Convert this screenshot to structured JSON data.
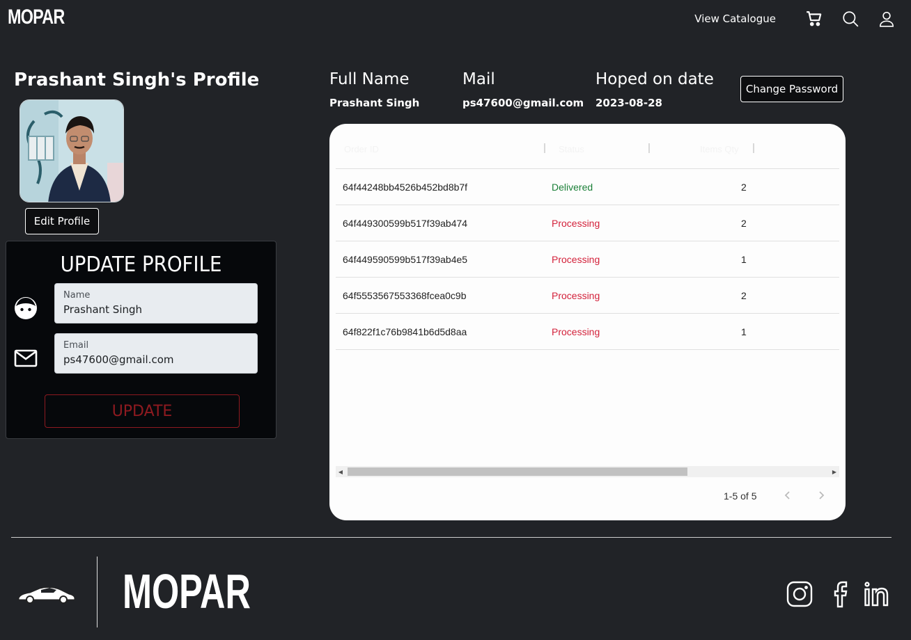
{
  "nav": {
    "logo": "MOPAR",
    "link": "View Catalogue",
    "icons": [
      "cart-icon",
      "search-icon",
      "user-icon"
    ]
  },
  "profile": {
    "title": "Prashant Singh's Profile",
    "edit_label": "Edit Profile"
  },
  "update": {
    "title": "UPDATE PROFILE",
    "name_label": "Name",
    "name_value": "Prashant Singh",
    "email_label": "Email",
    "email_value": "ps47600@gmail.com",
    "button": "UPDATE"
  },
  "info": {
    "full_name_head": "Full Name",
    "full_name": "Prashant Singh",
    "mail_head": "Mail",
    "mail": "ps47600@gmail.com",
    "date_head": "Hoped on date",
    "date": "2023-08-28",
    "change_password": "Change Password"
  },
  "orders": {
    "columns": [
      "Order ID",
      "Status",
      "Items Qty"
    ],
    "rows": [
      {
        "id": "64f44248bb4526b452bd8b7f",
        "status": "Delivered",
        "qty": "2"
      },
      {
        "id": "64f449300599b517f39ab474",
        "status": "Processing",
        "qty": "2"
      },
      {
        "id": "64f449590599b517f39ab4e5",
        "status": "Processing",
        "qty": "1"
      },
      {
        "id": "64f5553567553368fcea0c9b",
        "status": "Processing",
        "qty": "2"
      },
      {
        "id": "64f822f1c76b9841b6d5d8aa",
        "status": "Processing",
        "qty": "1"
      }
    ],
    "pagination": "1-5 of 5"
  },
  "footer": {
    "logo": "MOPAR",
    "social": [
      "instagram-icon",
      "facebook-icon",
      "linkedin-icon"
    ]
  },
  "colors": {
    "background": "#212327",
    "delivered": "#1a7f37",
    "processing": "#d3213a",
    "update_accent": "#8e1a20"
  }
}
